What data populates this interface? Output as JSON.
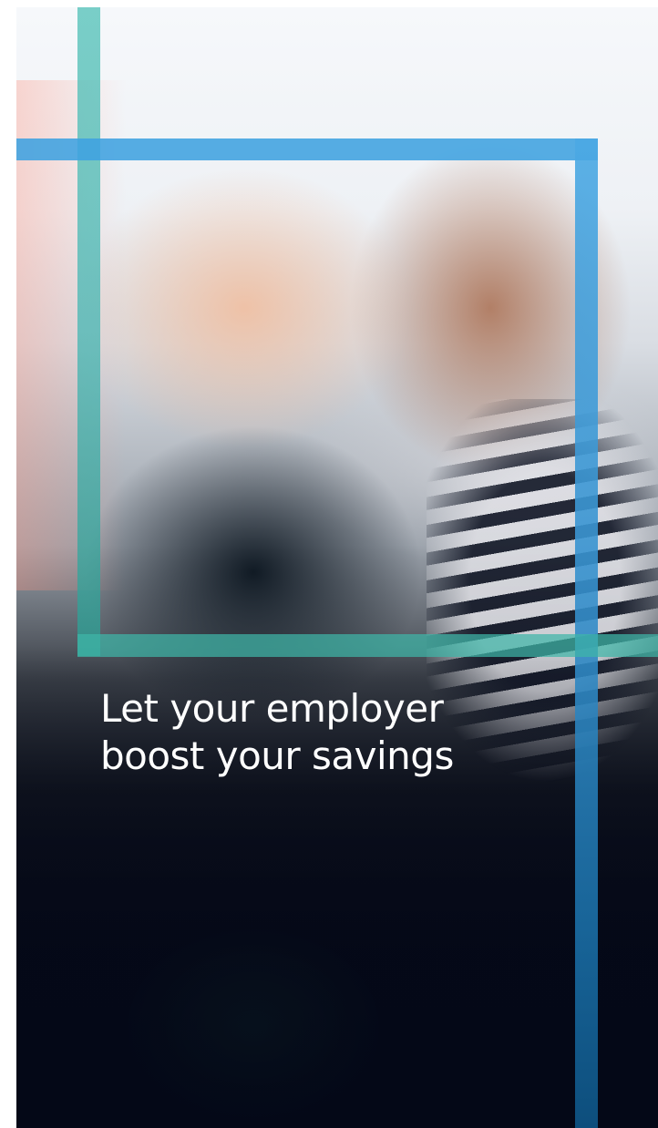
{
  "hero": {
    "headline": {
      "line1": "Let your employer",
      "line2": "boost your savings"
    },
    "image_description": "photo-of-two-people-in-aprons-looking-at-a-phone"
  },
  "colors": {
    "teal": "#3fb6a8",
    "blue": "#3fa2e0",
    "headline_text": "#ffffff",
    "dark_base": "#040817"
  }
}
